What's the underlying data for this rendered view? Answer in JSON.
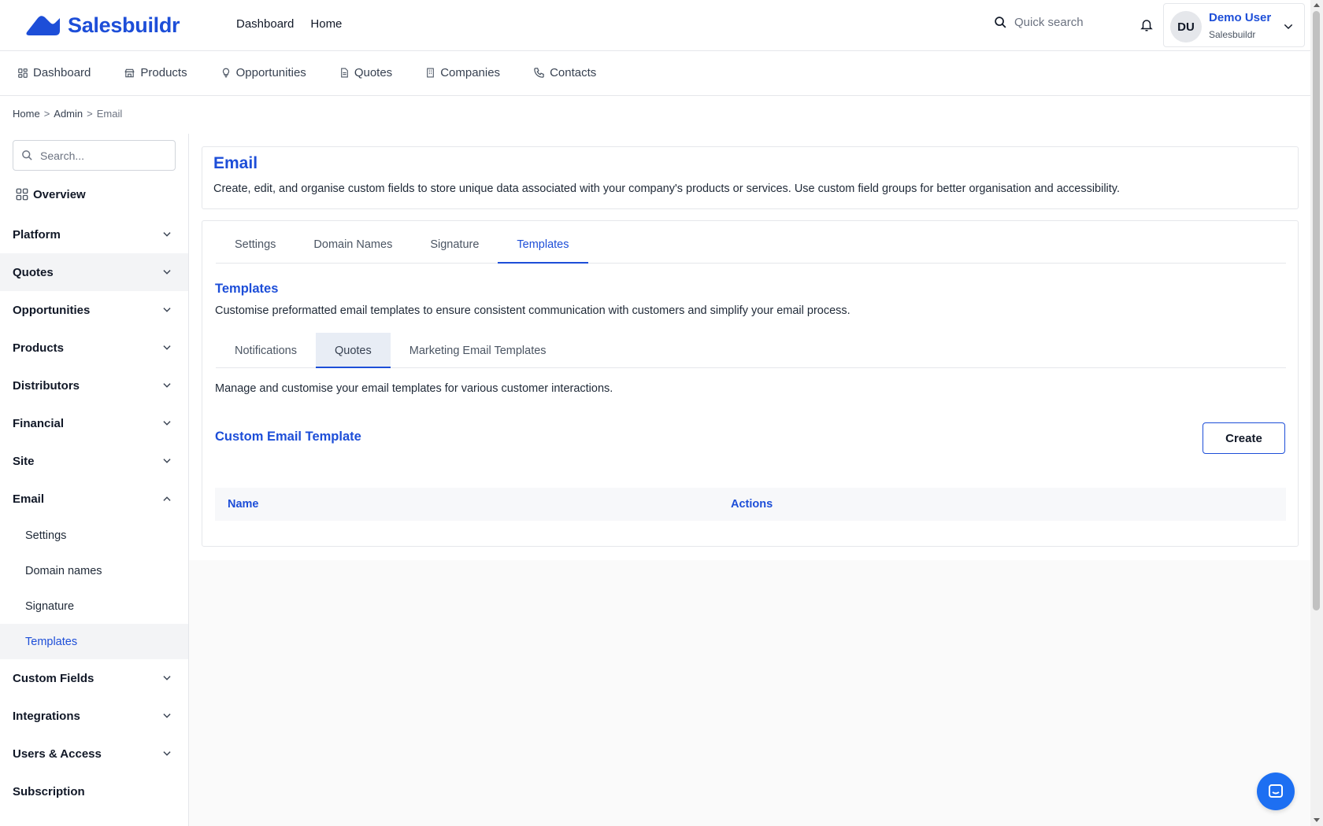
{
  "brand": {
    "name": "Salesbuildr",
    "color": "#1d4ed8"
  },
  "top_nav": [
    {
      "label": "Dashboard"
    },
    {
      "label": "Home"
    }
  ],
  "quick_search": {
    "placeholder": "Quick search",
    "icon": "search-icon"
  },
  "user": {
    "initials": "DU",
    "name": "Demo User",
    "org": "Salesbuildr"
  },
  "sub_nav": [
    {
      "label": "Dashboard",
      "icon": "grid-icon"
    },
    {
      "label": "Products",
      "icon": "store-icon"
    },
    {
      "label": "Opportunities",
      "icon": "lightbulb-icon"
    },
    {
      "label": "Quotes",
      "icon": "document-icon"
    },
    {
      "label": "Companies",
      "icon": "building-icon"
    },
    {
      "label": "Contacts",
      "icon": "phone-icon"
    }
  ],
  "breadcrumb": {
    "items": [
      "Home",
      "Admin",
      "Email"
    ],
    "separator": ">"
  },
  "sidebar": {
    "search_placeholder": "Search...",
    "overview": "Overview",
    "groups": [
      {
        "label": "Platform"
      },
      {
        "label": "Quotes"
      },
      {
        "label": "Opportunities"
      },
      {
        "label": "Products"
      },
      {
        "label": "Distributors"
      },
      {
        "label": "Financial"
      },
      {
        "label": "Site"
      },
      {
        "label": "Email",
        "expanded": true
      },
      {
        "label": "Custom Fields"
      },
      {
        "label": "Integrations"
      },
      {
        "label": "Users & Access"
      },
      {
        "label": "Subscription"
      }
    ],
    "email_items": [
      {
        "label": "Settings"
      },
      {
        "label": "Domain names"
      },
      {
        "label": "Signature"
      },
      {
        "label": "Templates",
        "current": true
      }
    ]
  },
  "header": {
    "title": "Email",
    "description": "Create, edit, and organise custom fields to store unique data associated with your company's products or services. Use custom field groups for better organisation and accessibility."
  },
  "tabs": [
    {
      "label": "Settings"
    },
    {
      "label": "Domain Names"
    },
    {
      "label": "Signature"
    },
    {
      "label": "Templates",
      "active": true
    }
  ],
  "templates": {
    "title": "Templates",
    "description": "Customise preformatted email templates to ensure consistent communication with customers and simplify your email process.",
    "subtabs": [
      {
        "label": "Notifications"
      },
      {
        "label": "Quotes",
        "active": true
      },
      {
        "label": "Marketing Email Templates"
      }
    ],
    "manage_description": "Manage and customise your email templates for various customer interactions.",
    "custom_title": "Custom Email Template",
    "create_label": "Create",
    "columns": [
      "Name",
      "Actions"
    ]
  }
}
